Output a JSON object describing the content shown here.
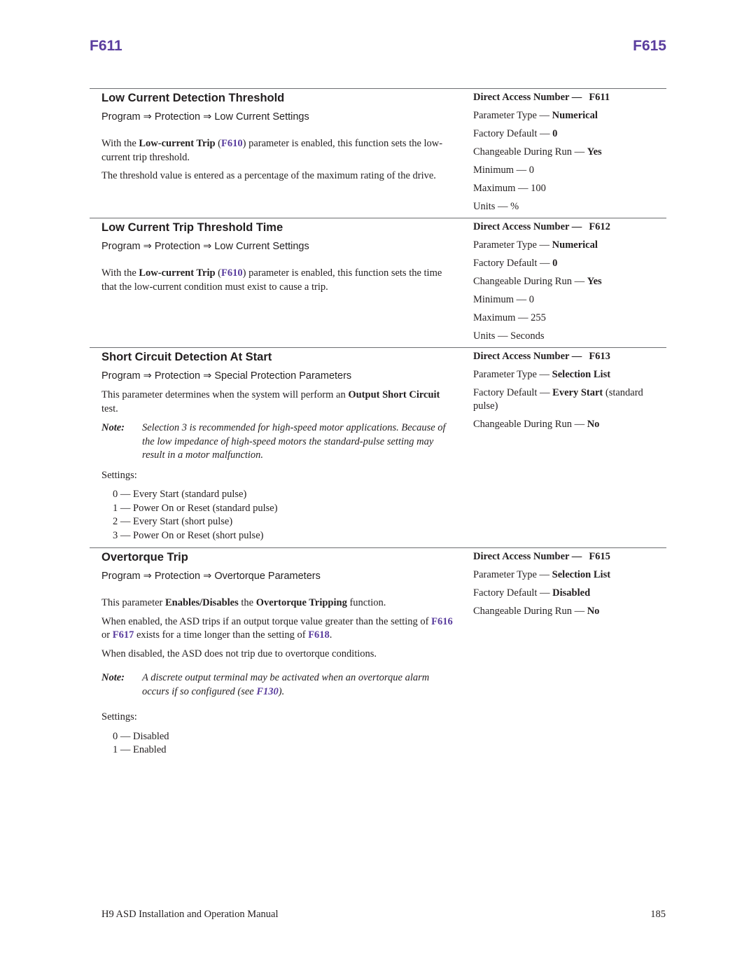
{
  "header": {
    "left": "F611",
    "right": "F615"
  },
  "arrow": "⇒",
  "dash": "—",
  "note_label": "Note:",
  "settings_label": "Settings:",
  "dan_label": "Direct Access Number —",
  "sections": [
    {
      "title": "Low Current Detection Threshold",
      "path": [
        "Program",
        "Protection",
        "Low Current Settings"
      ],
      "para1": {
        "pre": "With the ",
        "bold": "Low-current Trip",
        "open": " (",
        "link": "F610",
        "post": ") parameter is enabled, this function sets the low-current trip threshold."
      },
      "para2": "The threshold value is entered as a percentage of the maximum rating of the drive.",
      "props": {
        "dan": "F611",
        "type_label": "Parameter Type —",
        "type": "Numerical",
        "default_label": "Factory Default —",
        "default": "0",
        "run_label": "Changeable During Run —",
        "run": "Yes",
        "min_label": "Minimum —",
        "min": "0",
        "max_label": "Maximum —",
        "max": "100",
        "units_label": "Units —",
        "units": "%"
      }
    },
    {
      "title": "Low Current Trip Threshold Time",
      "path": [
        "Program",
        "Protection",
        "Low Current Settings"
      ],
      "para1": {
        "pre": "With the ",
        "bold": "Low-current Trip",
        "open": " (",
        "link": "F610",
        "post": ") parameter is enabled, this function sets the time that the low-current condition must exist to cause a trip."
      },
      "props": {
        "dan": "F612",
        "type_label": "Parameter Type —",
        "type": "Numerical",
        "default_label": "Factory Default —",
        "default": "0",
        "run_label": "Changeable During Run —",
        "run": "Yes",
        "min_label": "Minimum —",
        "min": "0",
        "max_label": "Maximum —",
        "max": "255",
        "units_label": "Units —",
        "units": "Seconds"
      }
    },
    {
      "title": "Short Circuit Detection At Start",
      "path": [
        "Program",
        "Protection",
        "Special Protection Parameters"
      ],
      "para1": {
        "pre": "This parameter determines when the system will perform an ",
        "bold": "Output Short Circuit",
        "post": " test."
      },
      "note": "Selection 3 is recommended for high-speed motor applications. Because of the low impedance of high-speed motors the standard-pulse setting may result in a motor malfunction.",
      "settings": [
        "0 — Every Start (standard pulse)",
        "1 — Power On or Reset (standard pulse)",
        "2 — Every Start (short pulse)",
        "3 — Power On or Reset (short pulse)"
      ],
      "props": {
        "dan": "F613",
        "type_label": "Parameter Type —",
        "type": "Selection List",
        "default_label": "Factory Default —",
        "default": "Every Start",
        "default_suffix": " (standard pulse)",
        "run_label": "Changeable During Run —",
        "run": "No"
      }
    },
    {
      "title": "Overtorque Trip",
      "path": [
        "Program",
        "Protection",
        "Overtorque Parameters"
      ],
      "para1": {
        "pre": "This parameter ",
        "bold1": "Enables/Disables",
        "mid": " the ",
        "bold2": "Overtorque Tripping",
        "post": " function."
      },
      "para2": {
        "pre": "When enabled, the ASD trips if an output torque value greater than the setting of ",
        "link1": "F616",
        "mid1": " or ",
        "link2": "F617",
        "mid2": " exists for a time longer than the setting of ",
        "link3": "F618",
        "post": "."
      },
      "para3": "When disabled, the ASD does not trip due to overtorque conditions.",
      "note": {
        "pre": "A discrete output terminal may be activated when an overtorque alarm occurs if so configured (see ",
        "link": "F130",
        "post": ")."
      },
      "settings": [
        "0 — Disabled",
        "1 — Enabled"
      ],
      "props": {
        "dan": "F615",
        "type_label": "Parameter Type —",
        "type": "Selection List",
        "default_label": "Factory Default —",
        "default": "Disabled",
        "run_label": "Changeable During Run —",
        "run": "No"
      }
    }
  ],
  "footer": {
    "manual": "H9 ASD Installation and Operation Manual",
    "page": "185"
  },
  "colors": {
    "accent": "#5a3d9e",
    "text": "#231f20",
    "rule": "#6d6e71"
  }
}
